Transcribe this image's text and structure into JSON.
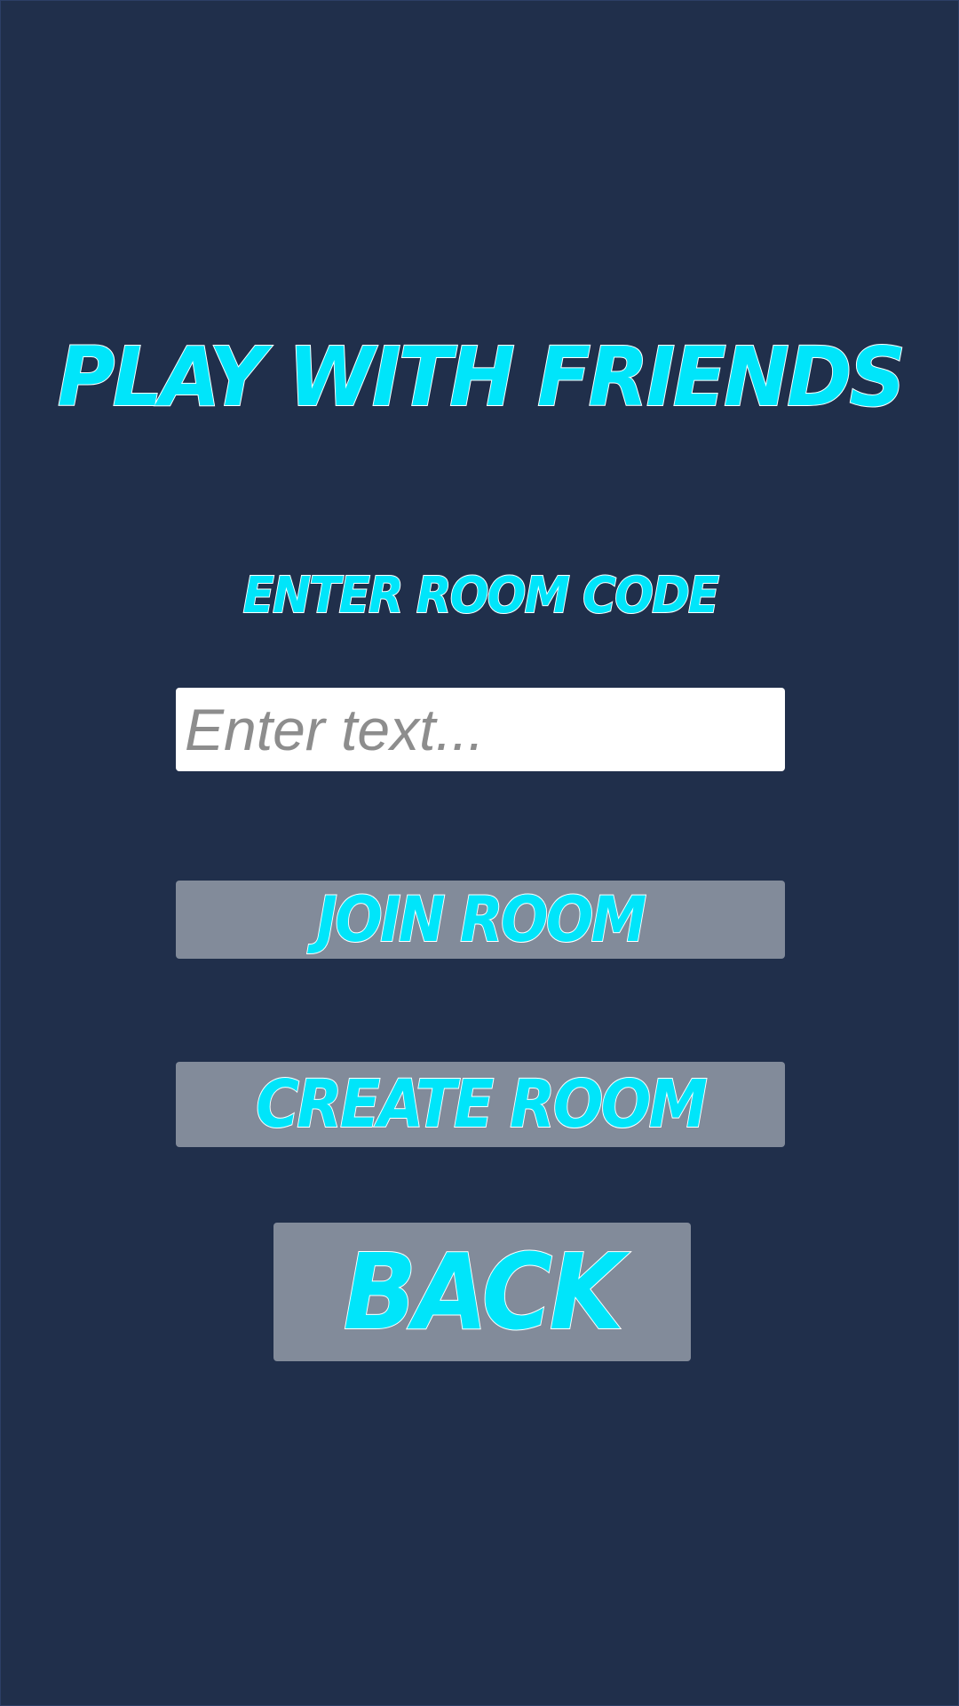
{
  "screen": {
    "title": "Play With Friends",
    "room_code_label": "Enter Room Code"
  },
  "room_code_input": {
    "value": "",
    "placeholder": "Enter text..."
  },
  "buttons": {
    "join_label": "Join Room",
    "create_label": "Create Room",
    "back_label": "Back"
  },
  "colors": {
    "background": "#202f4b",
    "text_accent": "#00e5fa",
    "text_outline": "#ffffff",
    "button_fill": "#828b9a",
    "input_fill": "#ffffff",
    "placeholder": "#8d8d8d"
  }
}
